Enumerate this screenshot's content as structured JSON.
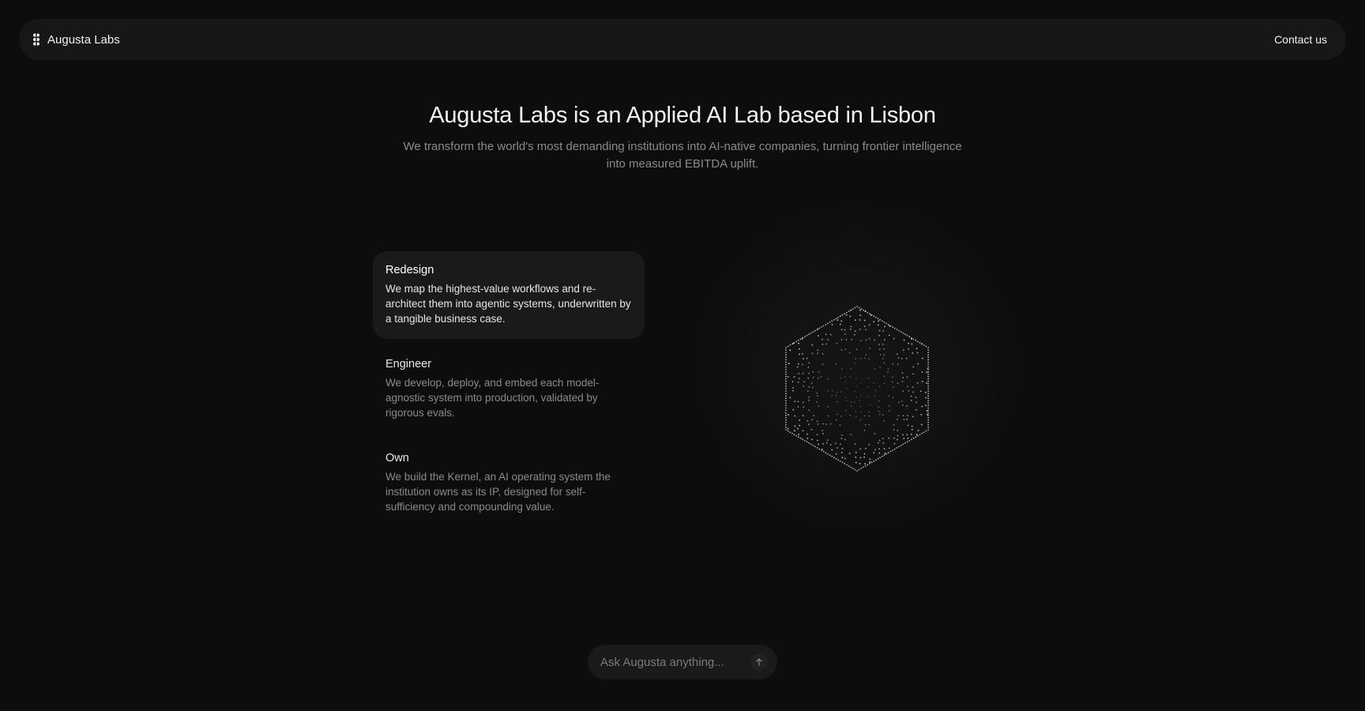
{
  "nav": {
    "brand": "Augusta Labs",
    "logo_icon": "augusta-logo-icon",
    "contact_label": "Contact us"
  },
  "hero": {
    "title": "Augusta Labs is an Applied AI Lab based in Lisbon",
    "subtitle": "We transform the world's most demanding institutions into AI-native companies, turning frontier intelligence into measured EBITDA uplift."
  },
  "steps": [
    {
      "title": "Redesign",
      "description": "We map the highest-value workflows and re-architect them into agentic systems, underwritten by a tangible business case.",
      "active": true
    },
    {
      "title": "Engineer",
      "description": "We develop, deploy, and embed each model-agnostic system into production, validated by rigorous evals.",
      "active": false
    },
    {
      "title": "Own",
      "description": "We build the Kernel, an AI operating system the institution owns as its IP, designed for self-sufficiency and compounding value.",
      "active": false
    }
  ],
  "visual": {
    "icon": "dotted-sphere-graphic"
  },
  "ask": {
    "placeholder": "Ask Augusta anything...",
    "send_icon": "arrow-up-icon"
  },
  "colors": {
    "background": "#0d0d0d",
    "surface": "#171717",
    "active_card": "#1a1a1a",
    "text_primary": "#f2f2f2",
    "text_muted": "#8a8a8a"
  }
}
